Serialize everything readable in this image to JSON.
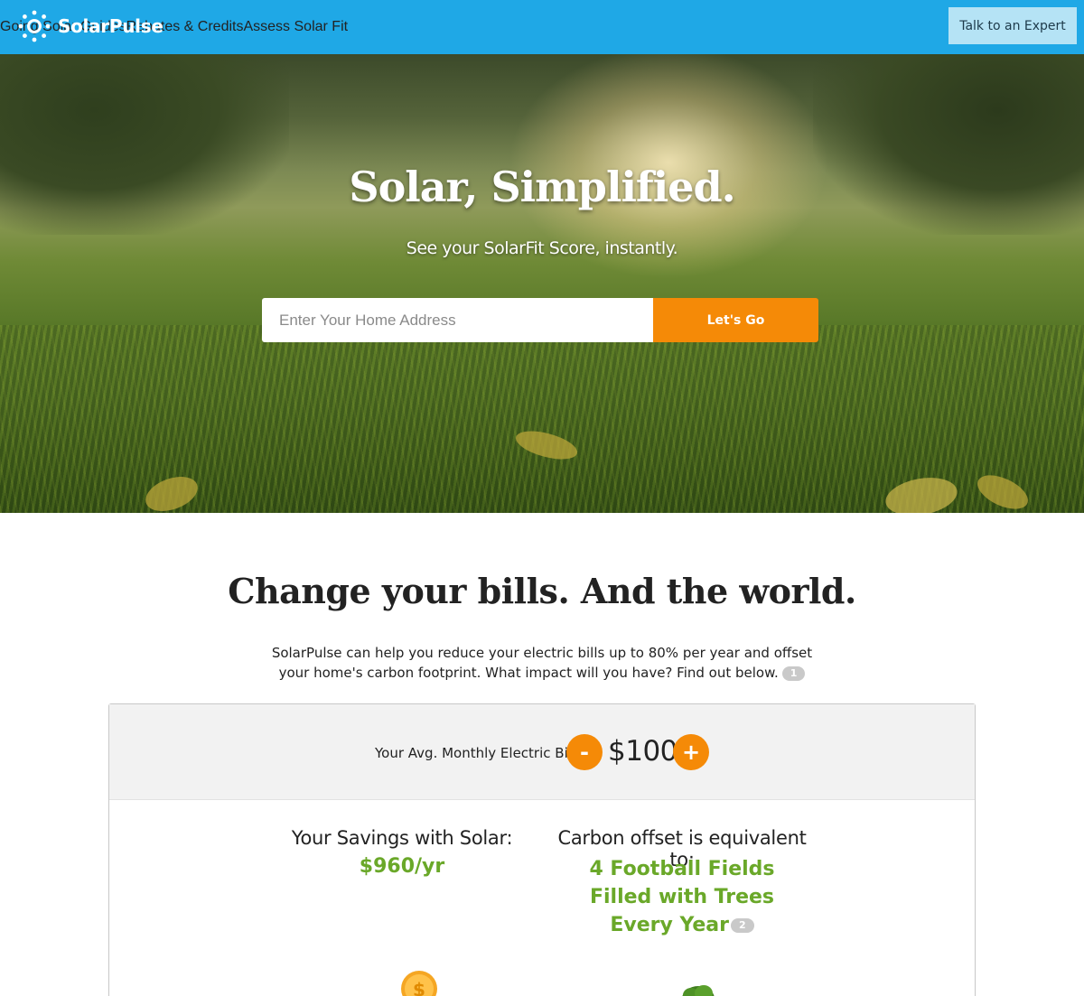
{
  "header": {
    "brand": "SolarPulse",
    "nav": [
      {
        "label": "Going Solar Guides"
      },
      {
        "label": "Rebates & Credits"
      },
      {
        "label": "Assess Solar Fit"
      }
    ],
    "cta_label": "Talk to an Expert",
    "colors": {
      "bar": "#1fa8e6",
      "cta_bg": "#b5e3f5"
    }
  },
  "hero": {
    "title": "Solar, Simplified.",
    "subtitle": "See your SolarFit Score, instantly.",
    "address_placeholder": "Enter Your Home Address",
    "address_value": "",
    "go_label": "Let's Go",
    "accent": "#f58a07"
  },
  "impact": {
    "title": "Change your bills. And the world.",
    "description": "SolarPulse can help you reduce your electric bills up to 80% per year and offset your home's carbon footprint. What impact will you have? Find out below.",
    "footnote_1": "1",
    "bill_label": "Your Avg. Monthly Electric Bill",
    "decrement_label": "-",
    "increment_label": "+",
    "bill_value": "$100",
    "savings_label": "Your Savings with Solar:",
    "savings_value": "$960/yr",
    "carbon_label": "Carbon offset is equivalent to:",
    "carbon_line1": "4 Football Fields",
    "carbon_line2": "Filled with Trees",
    "carbon_line3": "Every Year",
    "footnote_2": "2",
    "icons": [
      "coin-icon",
      "tree-icon"
    ],
    "green": "#6aa829"
  }
}
